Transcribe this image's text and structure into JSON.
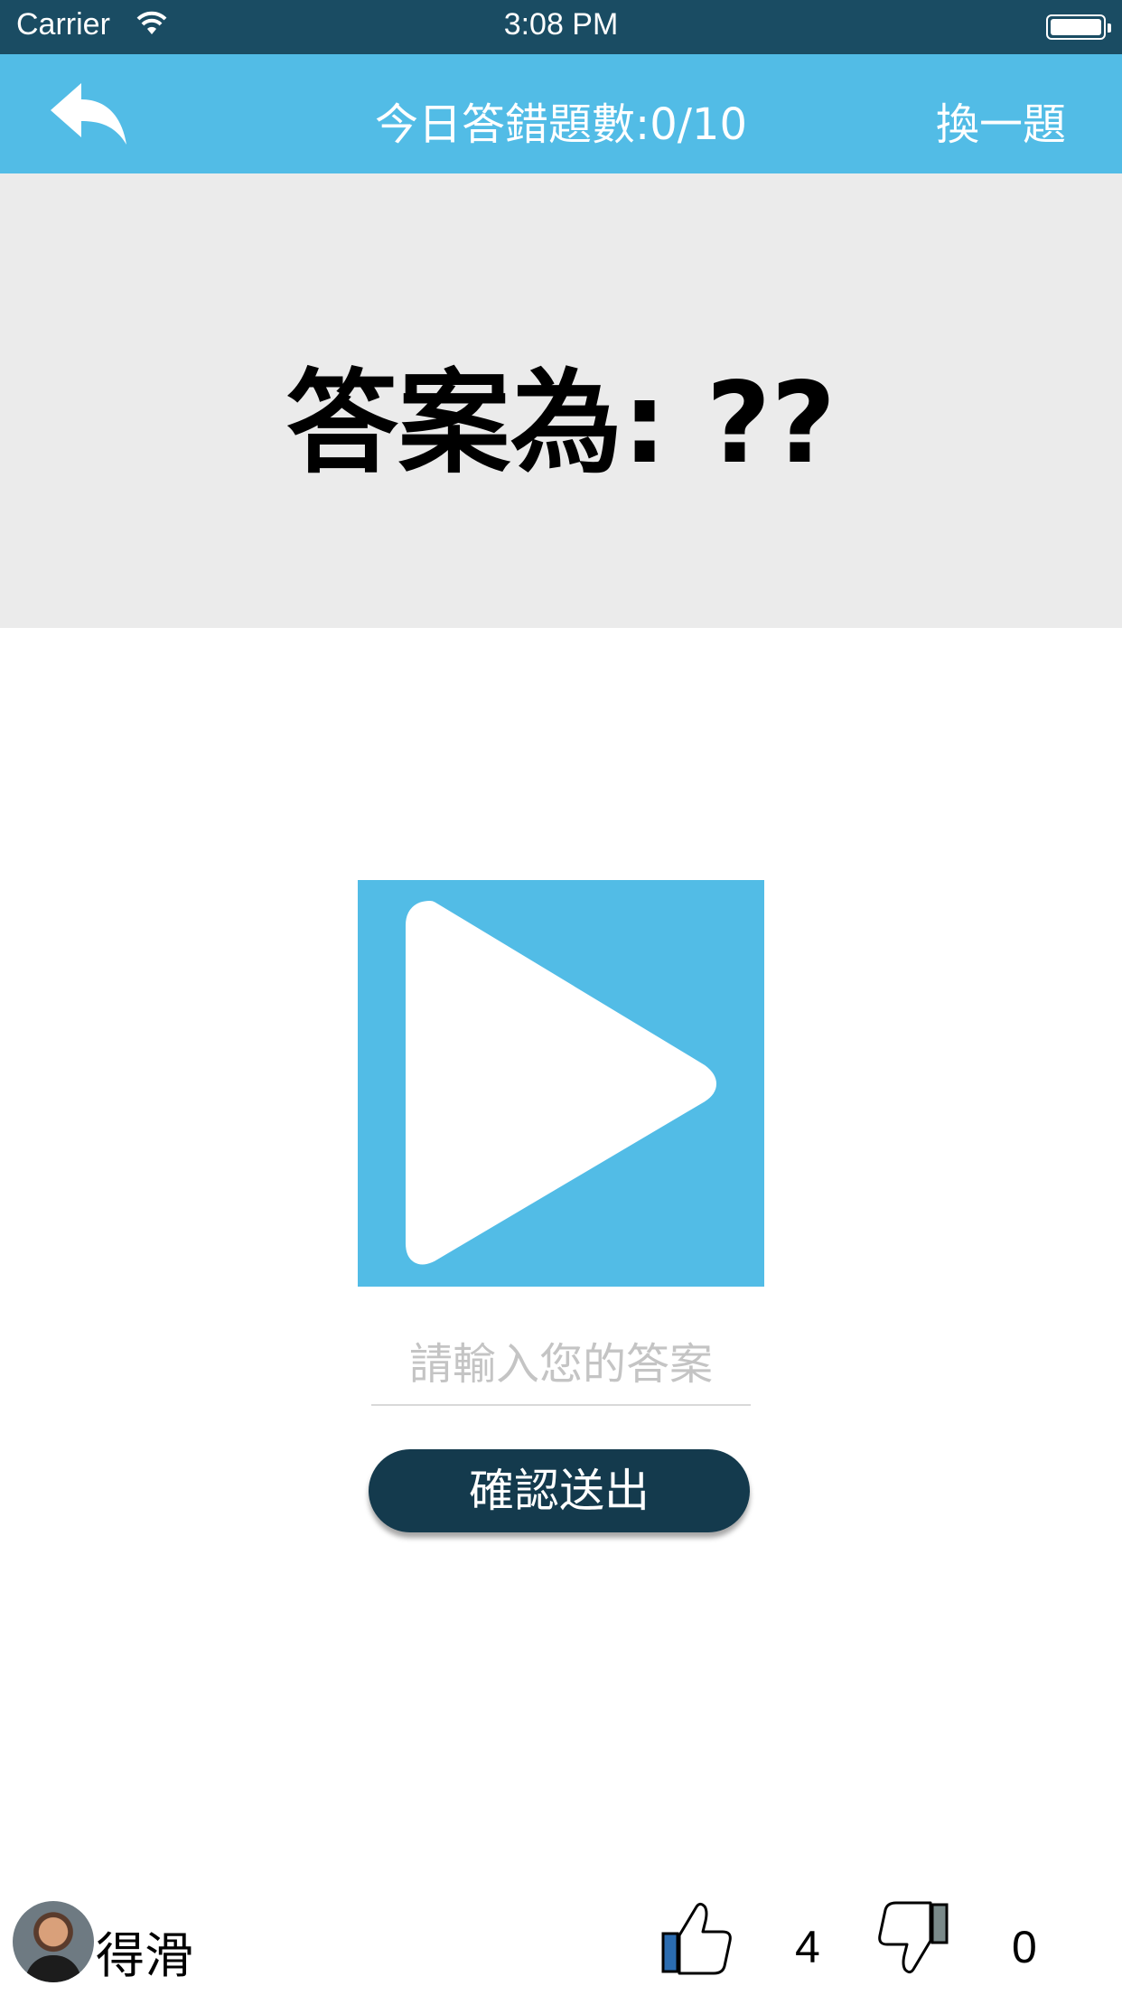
{
  "status_bar": {
    "carrier": "Carrier",
    "time": "3:08 PM"
  },
  "nav": {
    "title": "今日答錯題數:0/10",
    "skip_label": "換一題",
    "back_icon": "reply-arrow-icon"
  },
  "answer": {
    "text": "答案為: ??"
  },
  "player": {
    "icon": "play-icon"
  },
  "input": {
    "placeholder": "請輸入您的答案",
    "value": ""
  },
  "submit": {
    "label": "確認送出"
  },
  "footer": {
    "username": "得滑",
    "likes": "4",
    "dislikes": "0"
  },
  "colors": {
    "status_bar": "#1a4c63",
    "nav_bar": "#52bce6",
    "banner": "#ebebeb",
    "button": "#143a4d"
  }
}
